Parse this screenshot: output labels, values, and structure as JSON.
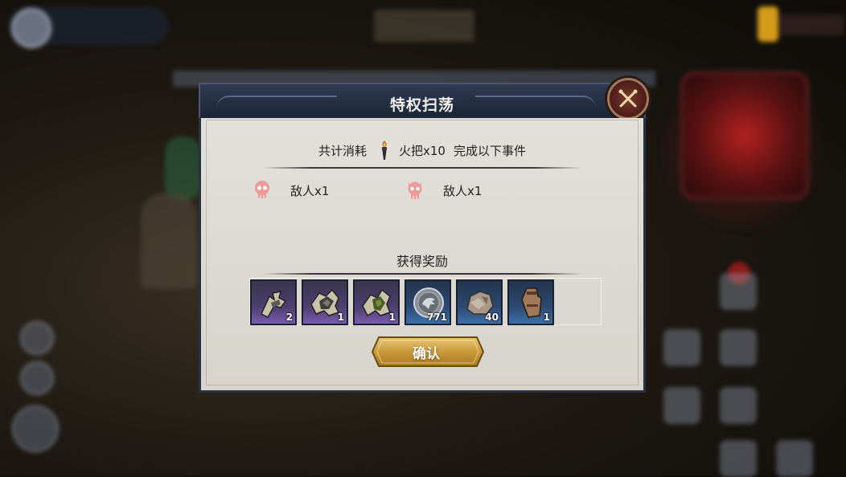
{
  "dialog": {
    "title": "特权扫荡",
    "cost": {
      "prefix": "共计消耗",
      "item_name": "火把x10",
      "suffix": "完成以下事件"
    },
    "events": [
      {
        "label": "敌人x1",
        "icon": "skull-icon",
        "color": "#e58a8a"
      },
      {
        "label": "敌人x1",
        "icon": "horned-skull-icon",
        "color": "#e58a8a"
      }
    ],
    "rewards_title": "获得奖励",
    "rewards": [
      {
        "icon": "gauntlet-piece-icon",
        "count": "2",
        "rarity": "purple"
      },
      {
        "icon": "shoulder-armor-piece-icon",
        "count": "1",
        "rarity": "purple"
      },
      {
        "icon": "green-armor-piece-icon",
        "count": "1",
        "rarity": "purple"
      },
      {
        "icon": "eagle-coin-icon",
        "count": "771",
        "rarity": "blue"
      },
      {
        "icon": "ore-stone-icon",
        "count": "40",
        "rarity": "blue"
      },
      {
        "icon": "leather-glove-icon",
        "count": "1",
        "rarity": "blue"
      }
    ],
    "confirm_label": "确认",
    "close_icon": "crossed-swords-close-icon"
  },
  "colors": {
    "header": "#1b2436",
    "body": "#dcd9d2",
    "confirm": "#c99a3a",
    "close": "#5a221c"
  }
}
